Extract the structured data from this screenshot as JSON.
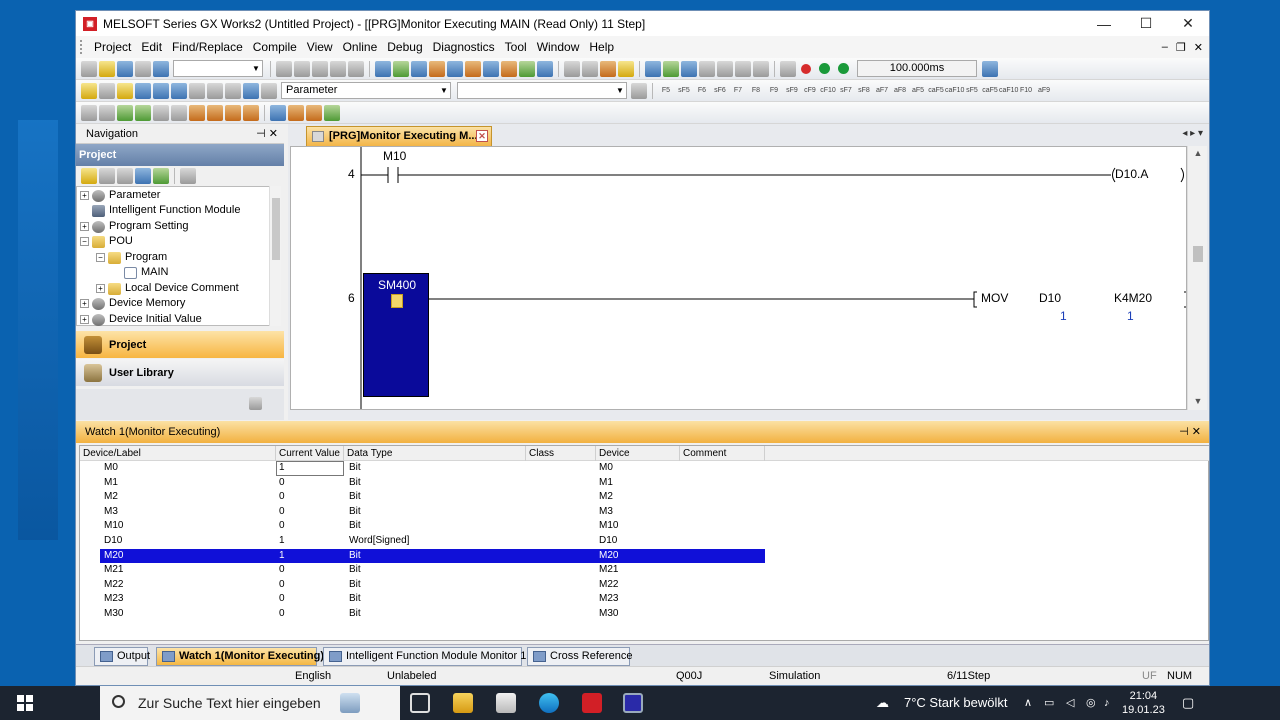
{
  "window": {
    "title": "MELSOFT Series GX Works2 (Untitled Project) - [[PRG]Monitor Executing MAIN (Read Only) 11 Step]",
    "minimize": "—",
    "maximize": "☐",
    "close": "✕"
  },
  "menu": {
    "items": [
      "Project",
      "Edit",
      "Find/Replace",
      "Compile",
      "View",
      "Online",
      "Debug",
      "Diagnostics",
      "Tool",
      "Window",
      "Help"
    ],
    "doc_controls": [
      "–",
      "❐",
      "✕"
    ]
  },
  "toolbar": {
    "scan_time": "100.000ms",
    "parameter_combo": "Parameter"
  },
  "navigation": {
    "title": "Navigation",
    "pin_icon": "pin-icon",
    "section": "Project",
    "tree": [
      {
        "label": "Parameter",
        "expander": "+",
        "icon": "gear"
      },
      {
        "label": "Intelligent Function Module",
        "expander": "",
        "icon": "mod"
      },
      {
        "label": "Program Setting",
        "expander": "+",
        "icon": "gear"
      },
      {
        "label": "POU",
        "expander": "−",
        "icon": "folder"
      },
      {
        "label": "Program",
        "expander": "−",
        "icon": "folder"
      },
      {
        "label": "MAIN",
        "expander": "",
        "icon": "doc"
      },
      {
        "label": "Local Device Comment",
        "expander": "+",
        "icon": "folder"
      },
      {
        "label": "Device Memory",
        "expander": "+",
        "icon": "gear"
      },
      {
        "label": "Device Initial Value",
        "expander": "+",
        "icon": "gear"
      }
    ],
    "buttons": {
      "project": "Project",
      "user_library": "User Library"
    }
  },
  "editor": {
    "tab_label": "[PRG]Monitor Executing M...",
    "close": "✕",
    "tab_nav": "◂ ▸ ▾",
    "ladder": {
      "rung1": {
        "step": "4",
        "contact": "M10",
        "coil": "D10.A"
      },
      "rung2": {
        "step": "6",
        "contact": "SM400",
        "instruction": "MOV",
        "src": "D10",
        "dst": "K4M20",
        "src_value": "1",
        "dst_value": "1"
      }
    }
  },
  "watch": {
    "title": "Watch 1(Monitor Executing)",
    "columns": [
      "Device/Label",
      "Current Value",
      "Data Type",
      "Class",
      "Device",
      "Comment"
    ],
    "rows": [
      {
        "label": "M0",
        "value": "1",
        "type": "Bit",
        "class": "",
        "device": "M0",
        "comment": ""
      },
      {
        "label": "M1",
        "value": "0",
        "type": "Bit",
        "class": "",
        "device": "M1",
        "comment": ""
      },
      {
        "label": "M2",
        "value": "0",
        "type": "Bit",
        "class": "",
        "device": "M2",
        "comment": ""
      },
      {
        "label": "M3",
        "value": "0",
        "type": "Bit",
        "class": "",
        "device": "M3",
        "comment": ""
      },
      {
        "label": "M10",
        "value": "0",
        "type": "Bit",
        "class": "",
        "device": "M10",
        "comment": ""
      },
      {
        "label": "D10",
        "value": "1",
        "type": "Word[Signed]",
        "class": "",
        "device": "D10",
        "comment": ""
      },
      {
        "label": "M20",
        "value": "1",
        "type": "Bit",
        "class": "",
        "device": "M20",
        "comment": "",
        "selected": true
      },
      {
        "label": "M21",
        "value": "0",
        "type": "Bit",
        "class": "",
        "device": "M21",
        "comment": ""
      },
      {
        "label": "M22",
        "value": "0",
        "type": "Bit",
        "class": "",
        "device": "M22",
        "comment": ""
      },
      {
        "label": "M23",
        "value": "0",
        "type": "Bit",
        "class": "",
        "device": "M23",
        "comment": ""
      },
      {
        "label": "M30",
        "value": "0",
        "type": "Bit",
        "class": "",
        "device": "M30",
        "comment": ""
      }
    ]
  },
  "bottom_tabs": [
    "Output",
    "Watch 1(Monitor Executing)",
    "Intelligent Function Module Monitor 1",
    "Cross Reference"
  ],
  "status": {
    "language": "English",
    "label": "Unlabeled",
    "cpu": "Q00J",
    "connection": "Simulation",
    "step": "6/11Step",
    "ovr": "UF",
    "num": "NUM"
  },
  "taskbar": {
    "search_placeholder": "Zur Suche Text hier eingeben",
    "weather": "7°C  Stark bewölkt",
    "time": "21:04",
    "date": "19.01.23"
  }
}
